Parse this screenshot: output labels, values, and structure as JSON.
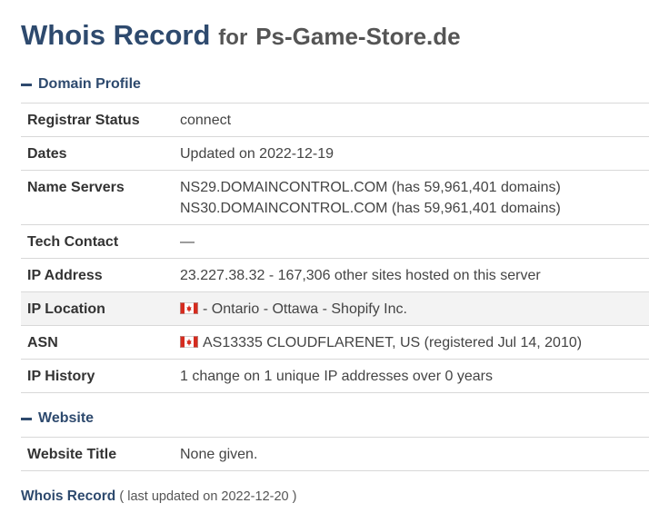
{
  "title": {
    "main": "Whois Record",
    "for": "for",
    "domain": "Ps-Game-Store.de"
  },
  "sections": {
    "profile": {
      "heading": "Domain Profile",
      "rows": [
        {
          "key": "Registrar Status",
          "value": "connect"
        },
        {
          "key": "Dates",
          "value": "Updated on 2022-12-19"
        },
        {
          "key": "Name Servers",
          "value1": "NS29.DOMAINCONTROL.COM (has 59,961,401 domains)",
          "value2": "NS30.DOMAINCONTROL.COM (has 59,961,401 domains)"
        },
        {
          "key": "Tech Contact",
          "value": "—"
        },
        {
          "key": "IP Address",
          "value": "23.227.38.32 - 167,306 other sites hosted on this server"
        },
        {
          "key": "IP Location",
          "value": "- Ontario - Ottawa - Shopify Inc.",
          "flag": "canada-flag-icon"
        },
        {
          "key": "ASN",
          "value": "AS13335 CLOUDFLARENET, US (registered Jul 14, 2010)",
          "flag": "canada-flag-icon"
        },
        {
          "key": "IP History",
          "value": "1 change on 1 unique IP addresses over 0 years"
        }
      ]
    },
    "website": {
      "heading": "Website",
      "rows": [
        {
          "key": "Website Title",
          "value": "None given."
        }
      ]
    }
  },
  "footer": {
    "link": "Whois Record",
    "note": "( last updated on 2022-12-20 )"
  },
  "colors": {
    "accent": "#2e4a6e",
    "flag_red": "#d52b1e",
    "row_shade": "#f3f3f3"
  }
}
